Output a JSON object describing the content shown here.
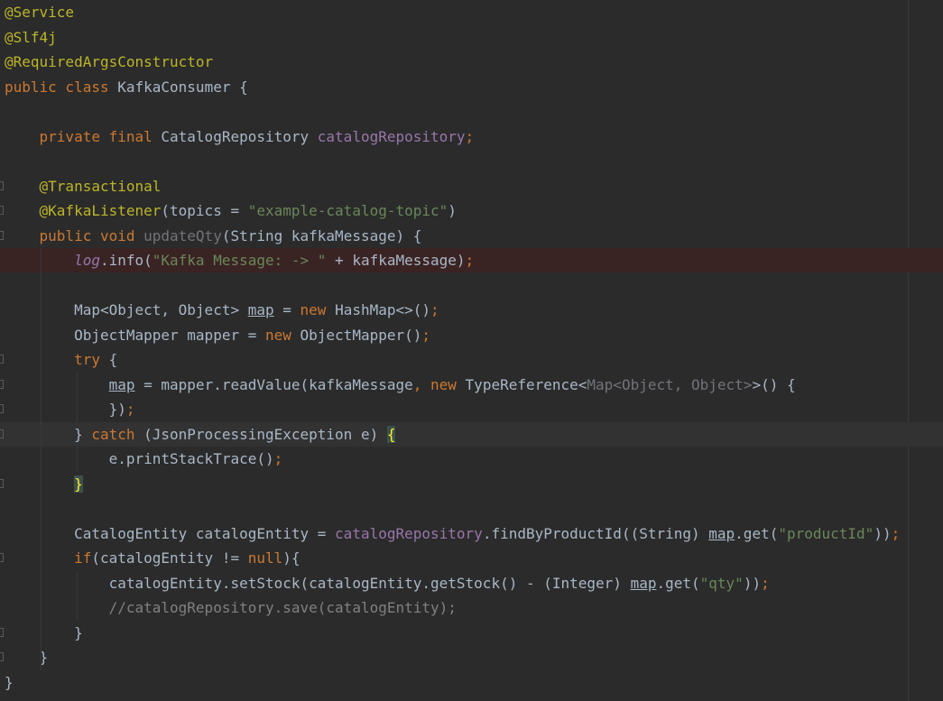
{
  "editor": {
    "lines": [
      {
        "tokens": [
          {
            "t": "@Service",
            "c": "ann"
          }
        ]
      },
      {
        "tokens": [
          {
            "t": "@Slf4j",
            "c": "ann"
          }
        ]
      },
      {
        "tokens": [
          {
            "t": "@RequiredArgsConstructor",
            "c": "ann"
          }
        ]
      },
      {
        "tokens": [
          {
            "t": "public class ",
            "c": "kw"
          },
          {
            "t": "KafkaConsumer {",
            "c": ""
          }
        ]
      },
      {
        "tokens": []
      },
      {
        "tokens": [
          {
            "t": "    ",
            "c": ""
          },
          {
            "t": "private final ",
            "c": "kw"
          },
          {
            "t": "CatalogRepository ",
            "c": ""
          },
          {
            "t": "catalogRepository",
            "c": "fld"
          },
          {
            "t": ";",
            "c": "kw"
          }
        ]
      },
      {
        "tokens": []
      },
      {
        "tokens": [
          {
            "t": "    ",
            "c": ""
          },
          {
            "t": "@Transactional",
            "c": "ann"
          }
        ],
        "gutter": true
      },
      {
        "tokens": [
          {
            "t": "    ",
            "c": ""
          },
          {
            "t": "@KafkaListener",
            "c": "ann"
          },
          {
            "t": "(topics = ",
            "c": ""
          },
          {
            "t": "\"example-catalog-topic\"",
            "c": "str"
          },
          {
            "t": ")",
            "c": ""
          }
        ],
        "gutter": true
      },
      {
        "tokens": [
          {
            "t": "    ",
            "c": ""
          },
          {
            "t": "public void ",
            "c": "kw"
          },
          {
            "t": "updateQty",
            "c": "unused"
          },
          {
            "t": "(String kafkaMessage) {",
            "c": ""
          }
        ],
        "gutter": true
      },
      {
        "tokens": [
          {
            "t": "        ",
            "c": ""
          },
          {
            "t": "log",
            "c": "fld-i"
          },
          {
            "t": ".info(",
            "c": ""
          },
          {
            "t": "\"Kafka Message: -> \"",
            "c": "str"
          },
          {
            "t": " + kafkaMessage)",
            "c": ""
          },
          {
            "t": ";",
            "c": "kw"
          }
        ],
        "highlight": "breakpoint"
      },
      {
        "tokens": []
      },
      {
        "tokens": [
          {
            "t": "        Map<Object, Object> ",
            "c": ""
          },
          {
            "t": "map",
            "c": "ul"
          },
          {
            "t": " = ",
            "c": ""
          },
          {
            "t": "new ",
            "c": "kw"
          },
          {
            "t": "HashMap<>()",
            "c": ""
          },
          {
            "t": ";",
            "c": "kw"
          }
        ]
      },
      {
        "tokens": [
          {
            "t": "        ObjectMapper mapper = ",
            "c": ""
          },
          {
            "t": "new ",
            "c": "kw"
          },
          {
            "t": "ObjectMapper()",
            "c": ""
          },
          {
            "t": ";",
            "c": "kw"
          }
        ]
      },
      {
        "tokens": [
          {
            "t": "        ",
            "c": ""
          },
          {
            "t": "try ",
            "c": "kw"
          },
          {
            "t": "{",
            "c": ""
          }
        ],
        "gutter": true
      },
      {
        "tokens": [
          {
            "t": "            ",
            "c": ""
          },
          {
            "t": "map",
            "c": "ul"
          },
          {
            "t": " = mapper.readValue(kafkaMessage",
            "c": ""
          },
          {
            "t": ", ",
            "c": "kw"
          },
          {
            "t": "new ",
            "c": "kw"
          },
          {
            "t": "TypeReference<",
            "c": ""
          },
          {
            "t": "Map<Object, Object>",
            "c": "unused"
          },
          {
            "t": ">() {",
            "c": ""
          }
        ],
        "gutter": true
      },
      {
        "tokens": [
          {
            "t": "            })",
            "c": ""
          },
          {
            "t": ";",
            "c": "kw"
          }
        ],
        "gutter": true
      },
      {
        "tokens": [
          {
            "t": "        } ",
            "c": ""
          },
          {
            "t": "catch ",
            "c": "kw"
          },
          {
            "t": "(JsonProcessingException e) ",
            "c": ""
          },
          {
            "t": "{",
            "c": "brace-hl"
          }
        ],
        "gutter": true,
        "highlight": "caret"
      },
      {
        "tokens": [
          {
            "t": "            e.printStackTrace()",
            "c": ""
          },
          {
            "t": ";",
            "c": "kw"
          }
        ]
      },
      {
        "tokens": [
          {
            "t": "        ",
            "c": ""
          },
          {
            "t": "}",
            "c": "brace-hl"
          }
        ],
        "gutter": true
      },
      {
        "tokens": []
      },
      {
        "tokens": [
          {
            "t": "        CatalogEntity catalogEntity = ",
            "c": ""
          },
          {
            "t": "catalogRepository",
            "c": "fld"
          },
          {
            "t": ".findByProductId((String) ",
            "c": ""
          },
          {
            "t": "map",
            "c": "ul"
          },
          {
            "t": ".get(",
            "c": ""
          },
          {
            "t": "\"productId\"",
            "c": "str"
          },
          {
            "t": "))",
            "c": ""
          },
          {
            "t": ";",
            "c": "kw"
          }
        ]
      },
      {
        "tokens": [
          {
            "t": "        ",
            "c": ""
          },
          {
            "t": "if",
            "c": "kw"
          },
          {
            "t": "(catalogEntity != ",
            "c": ""
          },
          {
            "t": "null",
            "c": "kw"
          },
          {
            "t": "){",
            "c": ""
          }
        ],
        "gutter": true
      },
      {
        "tokens": [
          {
            "t": "            catalogEntity.setStock(catalogEntity.getStock() - (Integer) ",
            "c": ""
          },
          {
            "t": "map",
            "c": "ul"
          },
          {
            "t": ".get(",
            "c": ""
          },
          {
            "t": "\"qty\"",
            "c": "str"
          },
          {
            "t": "))",
            "c": ""
          },
          {
            "t": ";",
            "c": "kw"
          }
        ]
      },
      {
        "tokens": [
          {
            "t": "            ",
            "c": ""
          },
          {
            "t": "//catalogRepository.save(catalogEntity);",
            "c": "cmt"
          }
        ]
      },
      {
        "tokens": [
          {
            "t": "        }",
            "c": ""
          }
        ],
        "gutter": true
      },
      {
        "tokens": [
          {
            "t": "    }",
            "c": ""
          }
        ],
        "gutter": true
      },
      {
        "tokens": [
          {
            "t": "}",
            "c": ""
          }
        ]
      }
    ]
  }
}
